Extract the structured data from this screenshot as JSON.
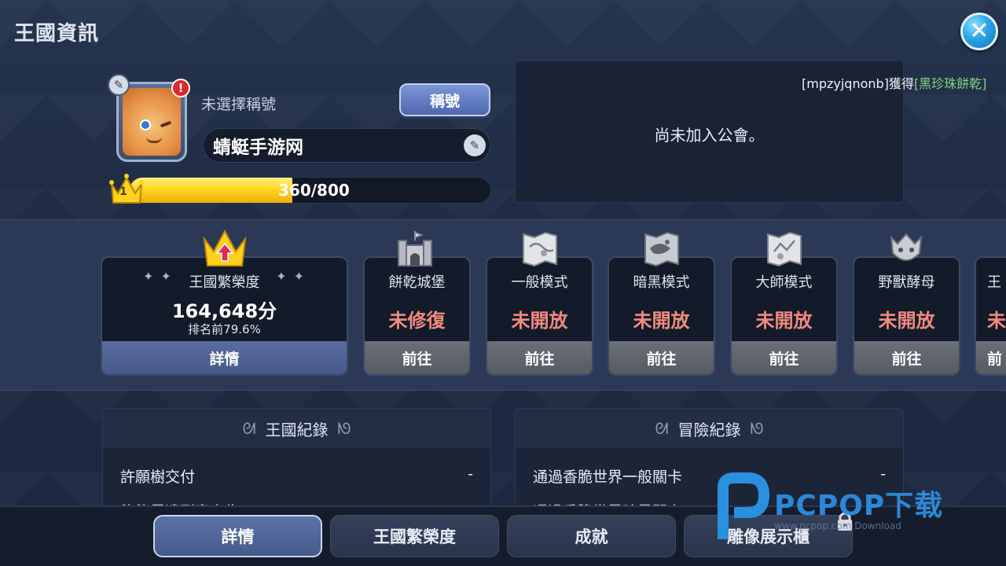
{
  "header": {
    "title": "王國資訊",
    "close_icon": "close-icon"
  },
  "profile": {
    "title_placeholder": "未選擇稱號",
    "title_button": "稱號",
    "name": "蜻蜓手游网",
    "level": "1",
    "xp_text": "360/800",
    "xp_progress": 0.45,
    "alert": "!",
    "edit_glyph": "✎"
  },
  "guild": {
    "message": "尚未加入公會。",
    "news_user": "[mpzyjqnonb]獲得",
    "news_item": "[黑珍珠餅乾]"
  },
  "prosperity": {
    "label": "王國繁榮度",
    "stars_left": "✦ ✦",
    "stars_right": "✦ ✦",
    "score": "164,648分",
    "rank": "排名前79.6%",
    "button": "詳情"
  },
  "modes": [
    {
      "label": "餅乾城堡",
      "status": "未修復",
      "button": "前往",
      "icon": "castle-icon"
    },
    {
      "label": "一般模式",
      "status": "未開放",
      "button": "前往",
      "icon": "map-icon"
    },
    {
      "label": "暗黑模式",
      "status": "未開放",
      "button": "前往",
      "icon": "dark-map-icon"
    },
    {
      "label": "大師模式",
      "status": "未開放",
      "button": "前往",
      "icon": "master-map-icon"
    },
    {
      "label": "野獸酵母",
      "status": "未開放",
      "button": "前往",
      "icon": "beast-icon"
    },
    {
      "label": "王",
      "status": "未",
      "button": "前",
      "icon": "unknown-icon"
    }
  ],
  "records": {
    "kingdom": {
      "title": "王國紀錄",
      "row1": "許願樹交付",
      "row1_value": "-",
      "row2": "能能里達到直交告"
    },
    "adventure": {
      "title": "冒險紀錄",
      "row1": "通過香脆世界一般關卡",
      "row1_value": "-",
      "row2": "通過香脆世界暗黑關卡"
    },
    "swirl_left": "ᘛ",
    "swirl_right": "ᘚ"
  },
  "tabs": {
    "details": "詳情",
    "prosperity": "王國繁榮度",
    "achievements": "成就",
    "statue": "雕像展示櫃"
  },
  "watermark": {
    "text": "PCPOP下载",
    "sub": "www.pcpop.com Download"
  },
  "colors": {
    "accent": "#4e68b0",
    "status_locked": "#f28a7e",
    "xp": "#ffd21e",
    "close": "#2aa4e8"
  }
}
